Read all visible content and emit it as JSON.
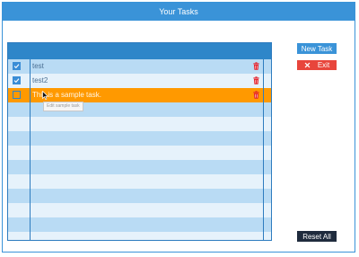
{
  "window": {
    "title": "Your Tasks"
  },
  "tasks": [
    {
      "text": "test",
      "done": true
    },
    {
      "text": "test2",
      "done": true
    }
  ],
  "new_task": {
    "placeholder": "This is a sample task.",
    "tooltip": "Edit sample task"
  },
  "buttons": {
    "new_task": "New Task",
    "exit": "Exit",
    "reset_all": "Reset All"
  },
  "colors": {
    "accent": "#3a93d8",
    "list_header": "#2e86c9",
    "selected_row": "#ff9900",
    "exit": "#e8453c",
    "reset": "#1f2b3d",
    "delete_icon": "#e5202a"
  }
}
